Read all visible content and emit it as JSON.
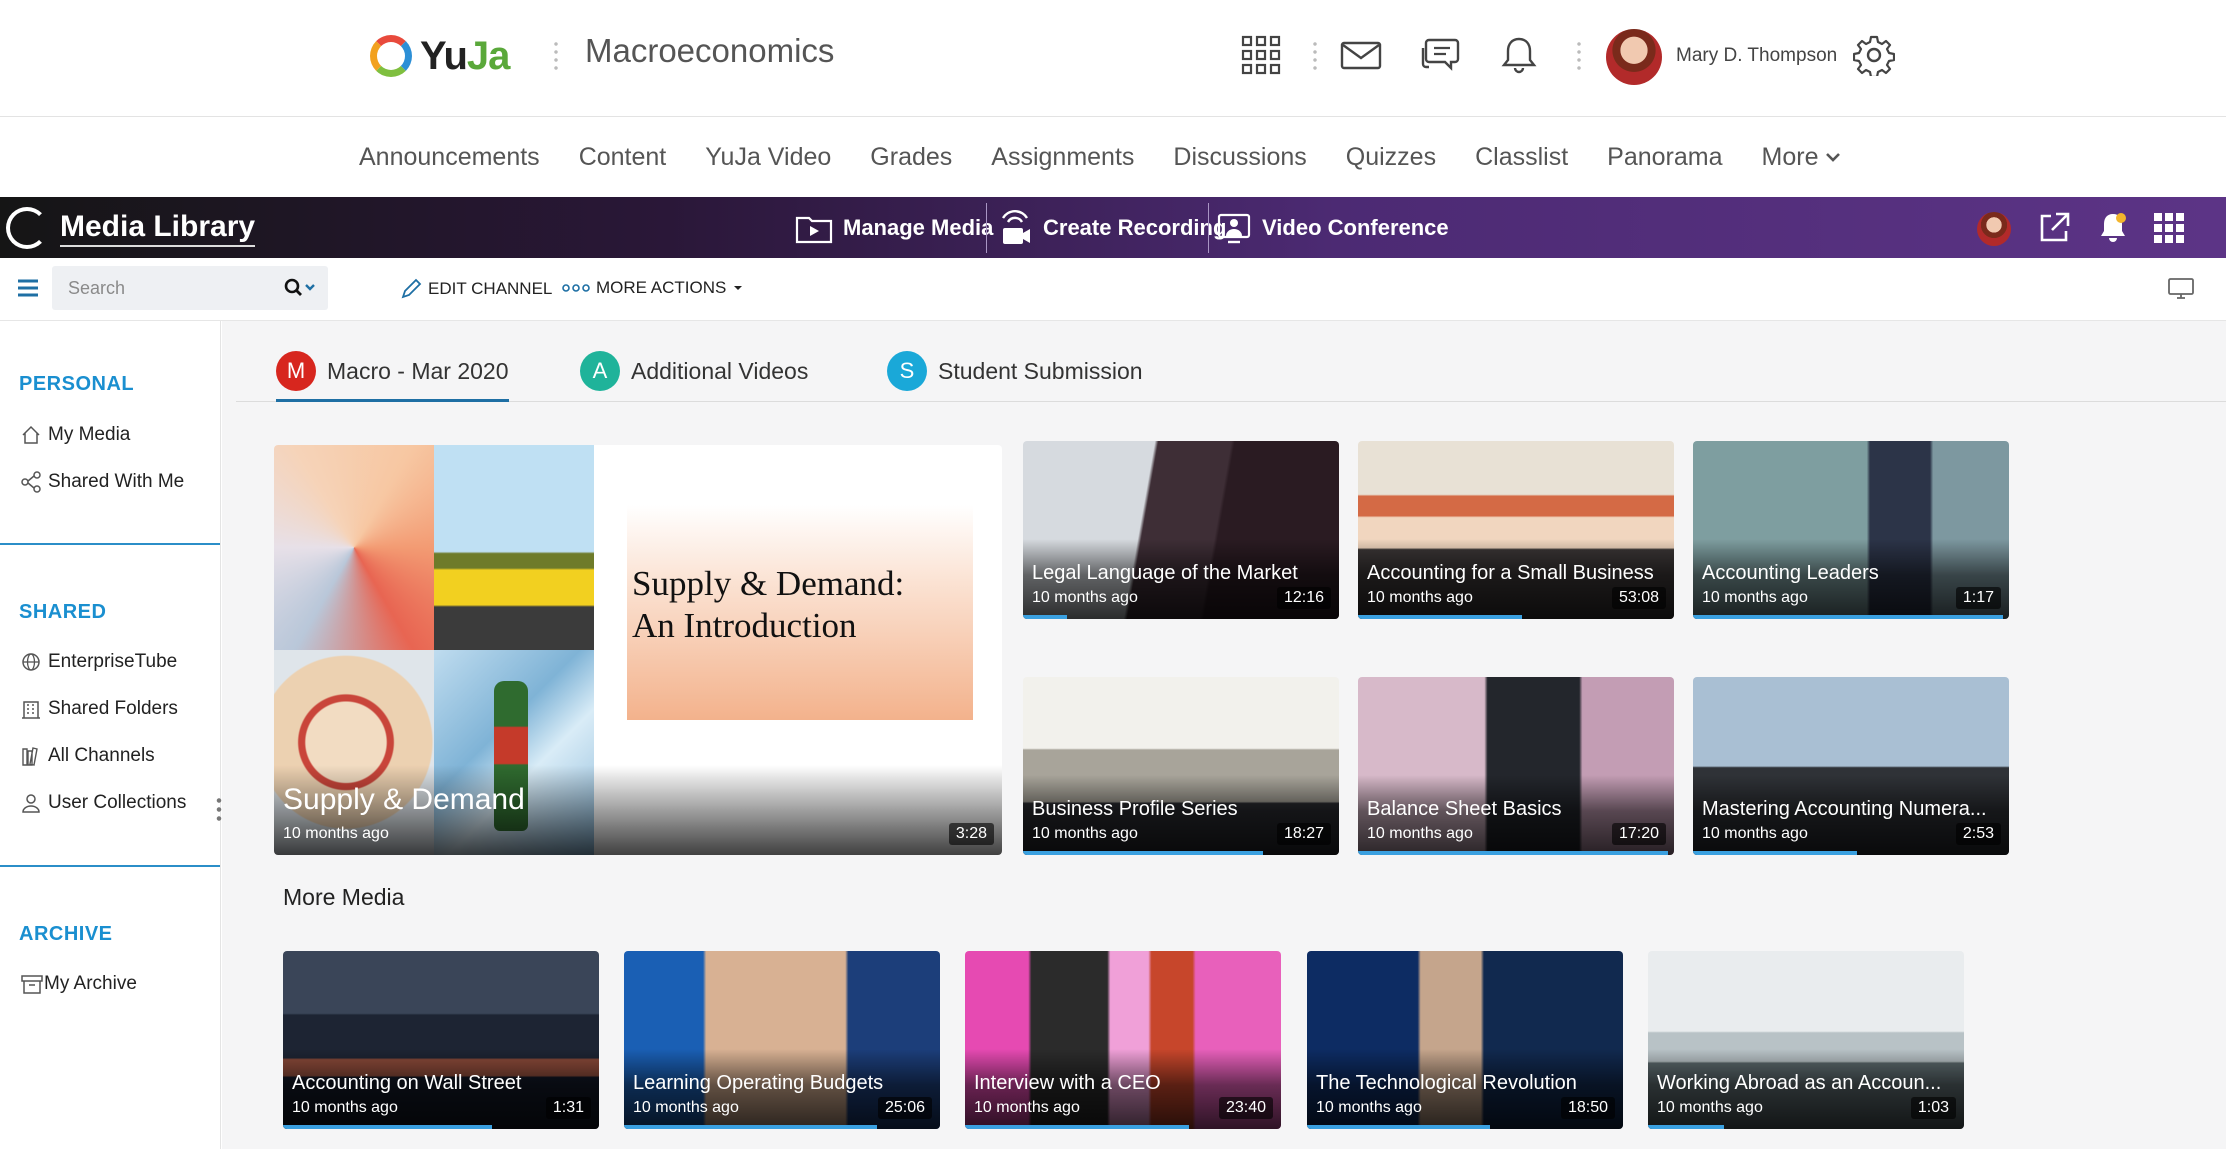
{
  "lms": {
    "logo_text_a": "Yu",
    "logo_text_b": "Ja",
    "course_title": "Macroeconomics",
    "user_name": "Mary D. Thompson",
    "nav": [
      "Announcements",
      "Content",
      "YuJa Video",
      "Grades",
      "Assignments",
      "Discussions",
      "Quizzes",
      "Classlist",
      "Panorama"
    ],
    "nav_more": "More"
  },
  "yuja": {
    "title": "Media Library",
    "manage_media": "Manage Media",
    "create_recording": "Create Recording",
    "video_conference": "Video Conference"
  },
  "toolbar": {
    "search_placeholder": "Search",
    "edit_channel": "EDIT CHANNEL",
    "more_actions": "MORE ACTIONS"
  },
  "sidebar": {
    "personal_heading": "PERSONAL",
    "my_media": "My Media",
    "shared_with_me": "Shared With Me",
    "shared_heading": "SHARED",
    "enterprise_tube": "EnterpriseTube",
    "shared_folders": "Shared Folders",
    "all_channels": "All Channels",
    "user_collections": "User Collections",
    "archive_heading": "ARCHIVE",
    "my_archive": "My Archive"
  },
  "tabs": [
    {
      "letter": "M",
      "label": "Macro - Mar 2020",
      "color": "#d7261e"
    },
    {
      "letter": "A",
      "label": "Additional Videos",
      "color": "#1fb39a"
    },
    {
      "letter": "S",
      "label": "Student Submission",
      "color": "#1aa8d8"
    }
  ],
  "featured": {
    "slide_line1": "Supply & Demand:",
    "slide_line2": "An Introduction",
    "title": "Supply & Demand",
    "ago": "10 months ago",
    "duration": "3:28"
  },
  "grid": [
    {
      "title": "Legal Language of the Market",
      "ago": "10 months ago",
      "duration": "12:16",
      "progress": 0.14
    },
    {
      "title": "Accounting for a Small Business",
      "ago": "10 months ago",
      "duration": "53:08",
      "progress": 0.52
    },
    {
      "title": "Accounting Leaders",
      "ago": "10 months ago",
      "duration": "1:17",
      "progress": 0.98
    },
    {
      "title": "Business Profile Series",
      "ago": "10 months ago",
      "duration": "18:27",
      "progress": 0.76
    },
    {
      "title": "Balance Sheet Basics",
      "ago": "10 months ago",
      "duration": "17:20",
      "progress": 0.98
    },
    {
      "title": "Mastering Accounting Numera...",
      "ago": "10 months ago",
      "duration": "2:53",
      "progress": 0.52
    }
  ],
  "more_media_heading": "More Media",
  "more_media": [
    {
      "title": "Accounting on Wall Street",
      "ago": "10 months ago",
      "duration": "1:31",
      "progress": 0.66
    },
    {
      "title": "Learning Operating Budgets",
      "ago": "10 months ago",
      "duration": "25:06",
      "progress": 0.8
    },
    {
      "title": "Interview with a CEO",
      "ago": "10 months ago",
      "duration": "23:40",
      "progress": 0.71
    },
    {
      "title": "The Technological Revolution",
      "ago": "10 months ago",
      "duration": "18:50",
      "progress": 0.58
    },
    {
      "title": "Working Abroad as an Accoun...",
      "ago": "10 months ago",
      "duration": "1:03",
      "progress": 0.24
    }
  ]
}
